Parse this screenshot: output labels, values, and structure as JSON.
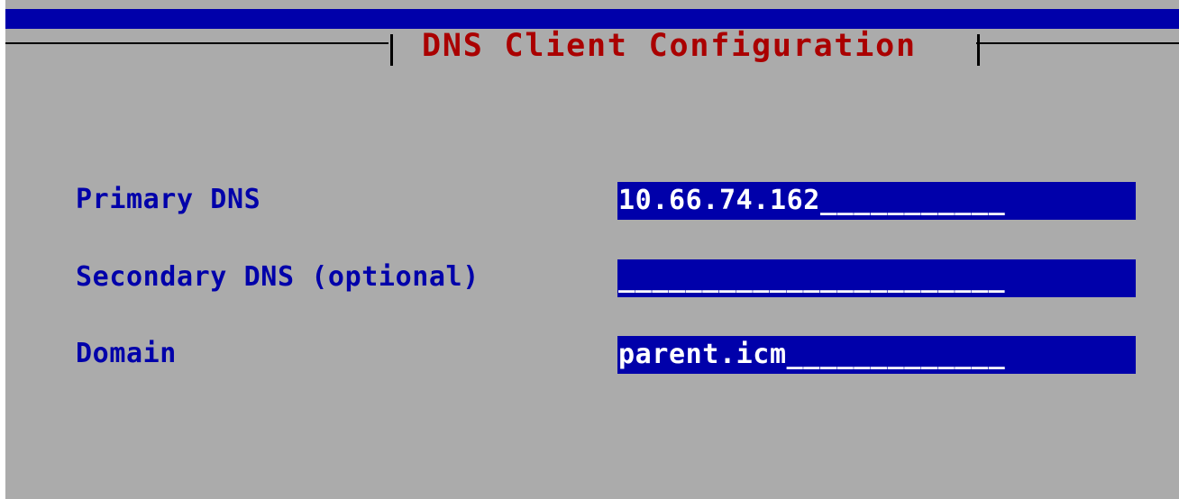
{
  "dialog": {
    "title": "DNS Client Configuration"
  },
  "fields": [
    {
      "label": "Primary DNS",
      "value": "10.66.74.162",
      "fill": "___________"
    },
    {
      "label": "Secondary DNS (optional)",
      "value": "",
      "fill": "_______________________"
    },
    {
      "label": "Domain",
      "value": "parent.icm",
      "fill": "_____________"
    }
  ],
  "colors": {
    "background": "#ababab",
    "label": "#0000aa",
    "title": "#aa0000",
    "input_background": "#0000aa",
    "input_text": "#ffffff",
    "top_bar": "#0000aa",
    "frame": "#000000"
  }
}
